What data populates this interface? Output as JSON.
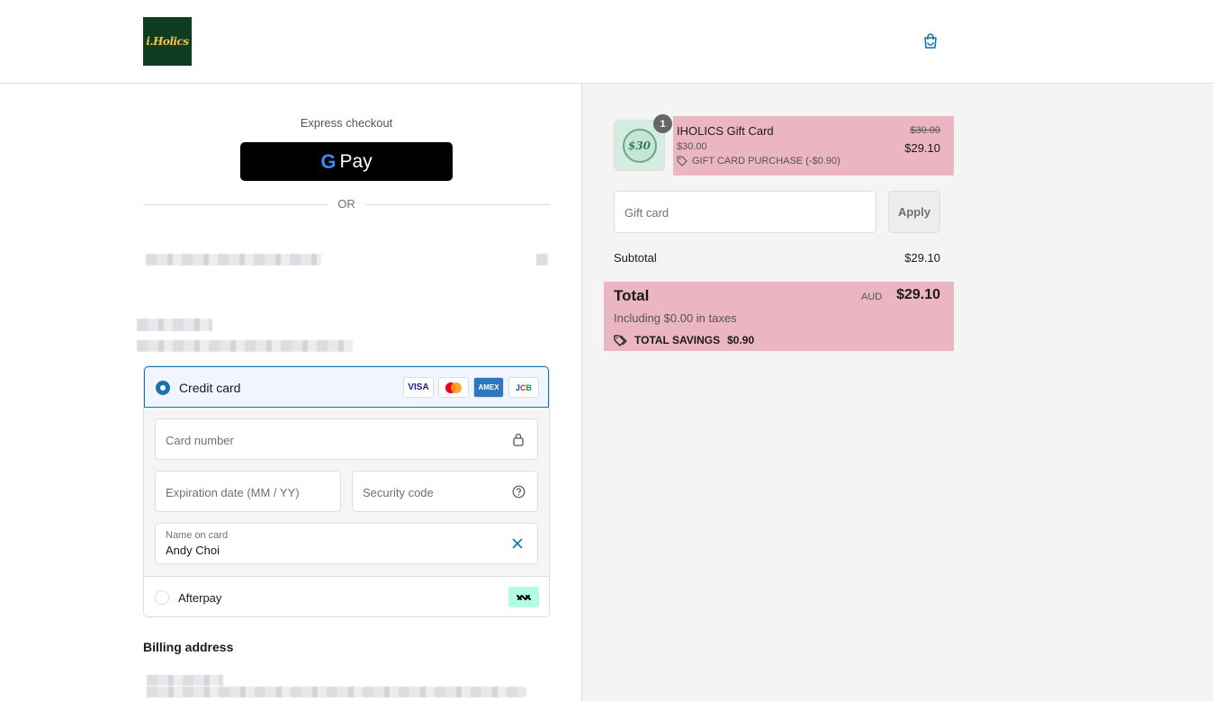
{
  "header": {
    "logo_text": "i.Holics",
    "cart_icon": "shopping-bag-icon"
  },
  "express": {
    "label": "Express checkout",
    "gpay_g": "G",
    "gpay_pay": "Pay",
    "or_text": "OR"
  },
  "payment": {
    "credit_card_label": "Credit card",
    "brands": [
      "VISA",
      "MC",
      "AMEX",
      "JCB"
    ],
    "card_number_placeholder": "Card number",
    "expiration_placeholder": "Expiration date (MM / YY)",
    "security_placeholder": "Security code",
    "name_label": "Name on card",
    "name_value": "Andy Choi",
    "afterpay_label": "Afterpay"
  },
  "billing": {
    "title": "Billing address"
  },
  "summary": {
    "item": {
      "quantity": "1",
      "thumb_text": "$30",
      "name": "IHOLICS Gift Card",
      "price_small": "$30.00",
      "discount": "GIFT CARD PURCHASE (-$0.90)",
      "old_price": "$30.00",
      "new_price": "$29.10"
    },
    "gift_card_placeholder": "Gift card",
    "apply_label": "Apply",
    "subtotal_label": "Subtotal",
    "subtotal_value": "$29.10",
    "total_label": "Total",
    "currency": "AUD",
    "total_value": "$29.10",
    "taxes_text": "Including $0.00 in taxes",
    "savings_label": "TOTAL SAVINGS",
    "savings_value": "$0.90"
  },
  "colors": {
    "accent": "#1773b0",
    "highlight": "#ebb6c1",
    "logo_bg": "#0e3d22"
  }
}
